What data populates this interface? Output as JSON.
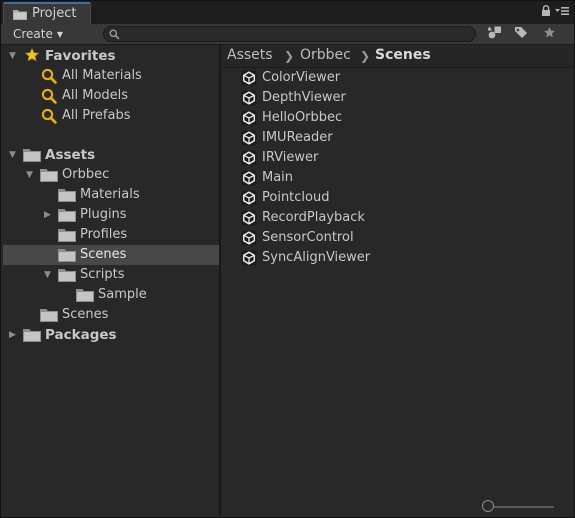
{
  "window": {
    "tab_label": "Project",
    "tab_icon": "folder-icon"
  },
  "toolbar": {
    "create_label": "Create",
    "search": {
      "value": "",
      "placeholder": ""
    },
    "buttons": [
      "filter-by-type-icon",
      "filter-by-label-icon",
      "favorite-star-icon"
    ]
  },
  "tree": {
    "favorites": {
      "label": "Favorites",
      "items": [
        {
          "label": "All Materials",
          "icon": "search-icon"
        },
        {
          "label": "All Models",
          "icon": "search-icon"
        },
        {
          "label": "All Prefabs",
          "icon": "search-icon"
        }
      ]
    },
    "assets": {
      "label": "Assets",
      "orbbec": {
        "label": "Orbbec",
        "children": [
          {
            "label": "Materials"
          },
          {
            "label": "Plugins"
          },
          {
            "label": "Profiles"
          },
          {
            "label": "Scenes"
          },
          {
            "label": "Scripts"
          }
        ],
        "scripts_child": {
          "label": "Sample"
        }
      },
      "scenes": {
        "label": "Scenes"
      }
    },
    "packages": {
      "label": "Packages"
    },
    "selected": "Scenes"
  },
  "breadcrumb": [
    "Assets",
    "Orbbec",
    "Scenes"
  ],
  "assets": [
    "ColorViewer",
    "DepthViewer",
    "HelloOrbbec",
    "IMUReader",
    "IRViewer",
    "Main",
    "Pointcloud",
    "RecordPlayback",
    "SensorControl",
    "SyncAlignViewer"
  ],
  "icon_size_slider": {
    "value": 0.0
  },
  "colors": {
    "selection": "#484848",
    "tab_accent": "#3d6ea8",
    "favorites_star": "#f2c40f",
    "search_lens": "#e8b400"
  }
}
